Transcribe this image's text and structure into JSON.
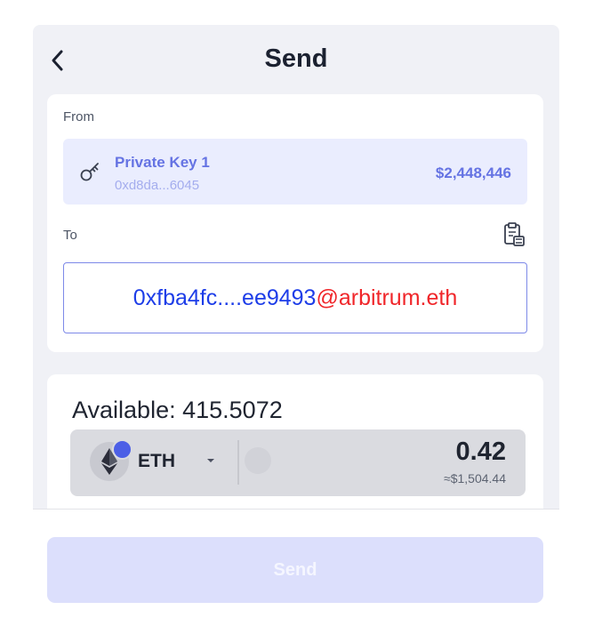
{
  "header": {
    "title": "Send"
  },
  "from": {
    "label": "From",
    "account_name": "Private Key 1",
    "account_address": "0xd8da...6045",
    "balance": "$2,448,446"
  },
  "to": {
    "label": "To",
    "address_main": "0xfba4fc....ee9493",
    "address_suffix": "@arbitrum.eth"
  },
  "amount": {
    "available_label": "Available:",
    "available_value": "415.5072",
    "token": "ETH",
    "value": "0.42",
    "usd_value": "≈$1,504.44"
  },
  "footer": {
    "send_label": "Send",
    "send_disabled": true
  },
  "colors": {
    "accent": "#6573e3",
    "address_blue": "#1d3de8",
    "address_red": "#f0262a",
    "disabled_button": "#dcdffc"
  },
  "icons": {
    "back": "chevron-left-icon",
    "key": "key-icon",
    "paste": "clipboard-paste-icon",
    "token": "eth-icon",
    "dropdown": "chevron-down-icon"
  }
}
